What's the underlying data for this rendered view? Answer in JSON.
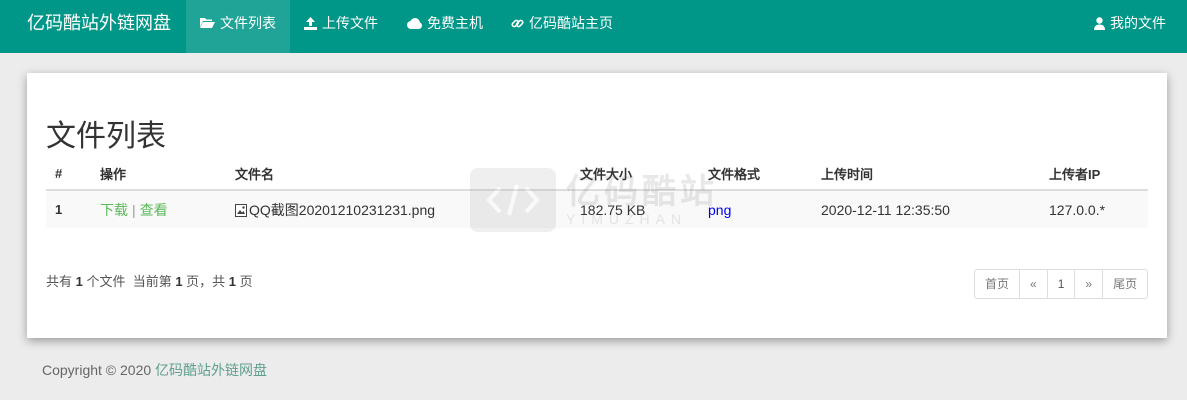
{
  "navbar": {
    "brand": "亿码酷站外链网盘",
    "items": [
      {
        "label": "文件列表",
        "icon": "folder-open-icon",
        "active": true
      },
      {
        "label": "上传文件",
        "icon": "upload-icon",
        "active": false
      },
      {
        "label": "免费主机",
        "icon": "cloud-icon",
        "active": false
      },
      {
        "label": "亿码酷站主页",
        "icon": "link-icon",
        "active": false
      }
    ],
    "user": {
      "label": "我的文件",
      "icon": "user-icon"
    },
    "color": "#009688"
  },
  "main": {
    "title": "文件列表",
    "columns": [
      "#",
      "操作",
      "文件名",
      "文件大小",
      "文件格式",
      "上传时间",
      "上传者IP"
    ],
    "rows": [
      {
        "num": "1",
        "download": "下载",
        "sep": "|",
        "view": "查看",
        "name": "QQ截图20201210231231.png",
        "size": "182.75 KB",
        "format": "png",
        "time": "2020-12-11 12:35:50",
        "ip": "127.0.0.*"
      }
    ],
    "summary": {
      "t1": "共有 ",
      "count": "1",
      "t2": " 个文件  当前第 ",
      "page": "1",
      "t3": " 页，共 ",
      "pages": "1",
      "t4": " 页"
    },
    "pagination": {
      "first": "首页",
      "prev": "«",
      "current": "1",
      "next": "»",
      "last": "尾页"
    }
  },
  "footer": {
    "text": "Copyright © 2020 ",
    "link": "亿码酷站外链网盘"
  },
  "watermark": {
    "text": "亿码酷站",
    "sub": "YIMUZHAN"
  }
}
